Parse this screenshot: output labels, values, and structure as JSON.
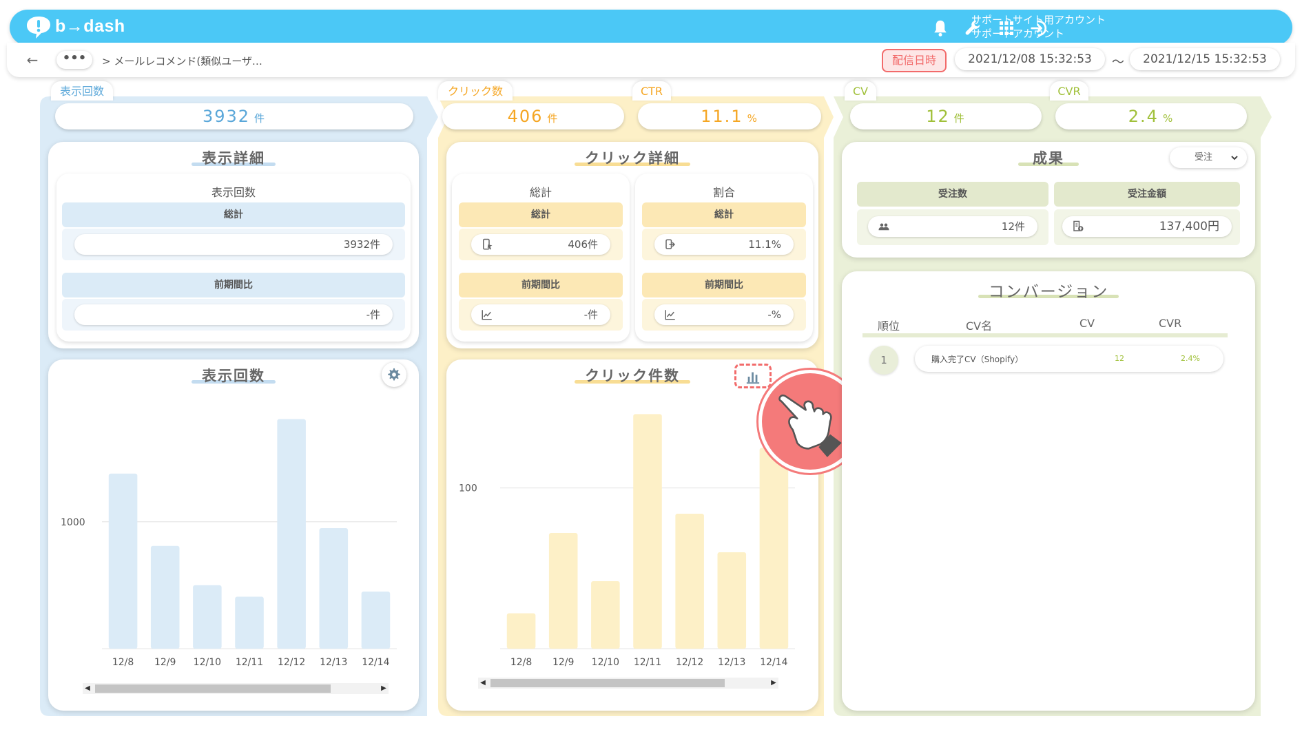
{
  "app": {
    "logo_text": "b→dash",
    "account_line1": "サポートサイト用アカウント",
    "account_line2": "サポートアカウント"
  },
  "icons": {
    "bell": "bell-icon",
    "wrench": "wrench-icon",
    "grid": "grid-icon",
    "logout": "logout-icon",
    "back": "back-arrow-icon",
    "gear": "gear-icon",
    "bar_chart": "bar-chart-icon"
  },
  "subbar": {
    "back_symbol": "←",
    "more_label": "•••",
    "breadcrumb": "> メールレコメンド(類似ユーザ…",
    "date_label": "配信日時",
    "date_from": "2021/12/08 15:32:53",
    "tilde": "〜",
    "date_to": "2021/12/15 15:32:53"
  },
  "colors": {
    "blue_accent": "#5aa7d9",
    "orange_accent": "#f5a623",
    "green_accent": "#a0c03a",
    "blue_bg": "#dbebf7",
    "yellow_bg": "#fdf0c7",
    "green_bg": "#eaf0d8"
  },
  "kpis": {
    "impressions": {
      "label": "表示回数",
      "value": "3932",
      "unit": "件"
    },
    "clicks": {
      "label": "クリック数",
      "value": "406",
      "unit": "件"
    },
    "ctr": {
      "label": "CTR",
      "value": "11.1",
      "unit": "%"
    },
    "cv": {
      "label": "CV",
      "value": "12",
      "unit": "件"
    },
    "cvr": {
      "label": "CVR",
      "value": "2.4",
      "unit": "%"
    }
  },
  "impression_detail": {
    "title": "表示詳細",
    "section": "表示回数",
    "total_label": "総計",
    "total_value": "3932件",
    "prev_label": "前期間比",
    "prev_value": "-件"
  },
  "click_detail": {
    "title": "クリック詳細",
    "left_section": "総計",
    "right_section": "割合",
    "total_label": "総計",
    "left_total_value": "406件",
    "right_total_value": "11.1%",
    "prev_label": "前期間比",
    "left_prev_value": "-件",
    "right_prev_value": "-%"
  },
  "results": {
    "title": "成果",
    "dropdown_value": "受注",
    "orders_label": "受注数",
    "orders_value": "12件",
    "amount_label": "受注金額",
    "amount_value": "137,400円"
  },
  "conversion": {
    "title": "コンバージョン",
    "headers": [
      "順位",
      "CV名",
      "CV",
      "CVR"
    ],
    "rows": [
      {
        "rank": "1",
        "name": "購入完了CV（Shopify）",
        "cv": "12",
        "cvr": "2.4%"
      }
    ]
  },
  "impression_chart": {
    "title": "表示回数"
  },
  "click_chart": {
    "title": "クリック件数"
  },
  "chart_data": [
    {
      "type": "bar",
      "title": "表示回数",
      "categories": [
        "12/8",
        "12/9",
        "12/10",
        "12/11",
        "12/12",
        "12/13",
        "12/14"
      ],
      "values": [
        1380,
        810,
        500,
        410,
        1810,
        950,
        450
      ],
      "ylim": [
        0,
        1900
      ],
      "yticks": [
        1000
      ],
      "ytick_labels": [
        "1000"
      ],
      "grid": true,
      "color": "#dbebf7"
    },
    {
      "type": "bar",
      "title": "クリック件数",
      "categories": [
        "12/8",
        "12/9",
        "12/10",
        "12/11",
        "12/12",
        "12/13",
        "12/14"
      ],
      "values": [
        22,
        72,
        42,
        146,
        84,
        60,
        125
      ],
      "ylim": [
        0,
        150
      ],
      "yticks": [
        100
      ],
      "ytick_labels": [
        "100"
      ],
      "grid": true,
      "color": "#fdf0c7"
    }
  ]
}
